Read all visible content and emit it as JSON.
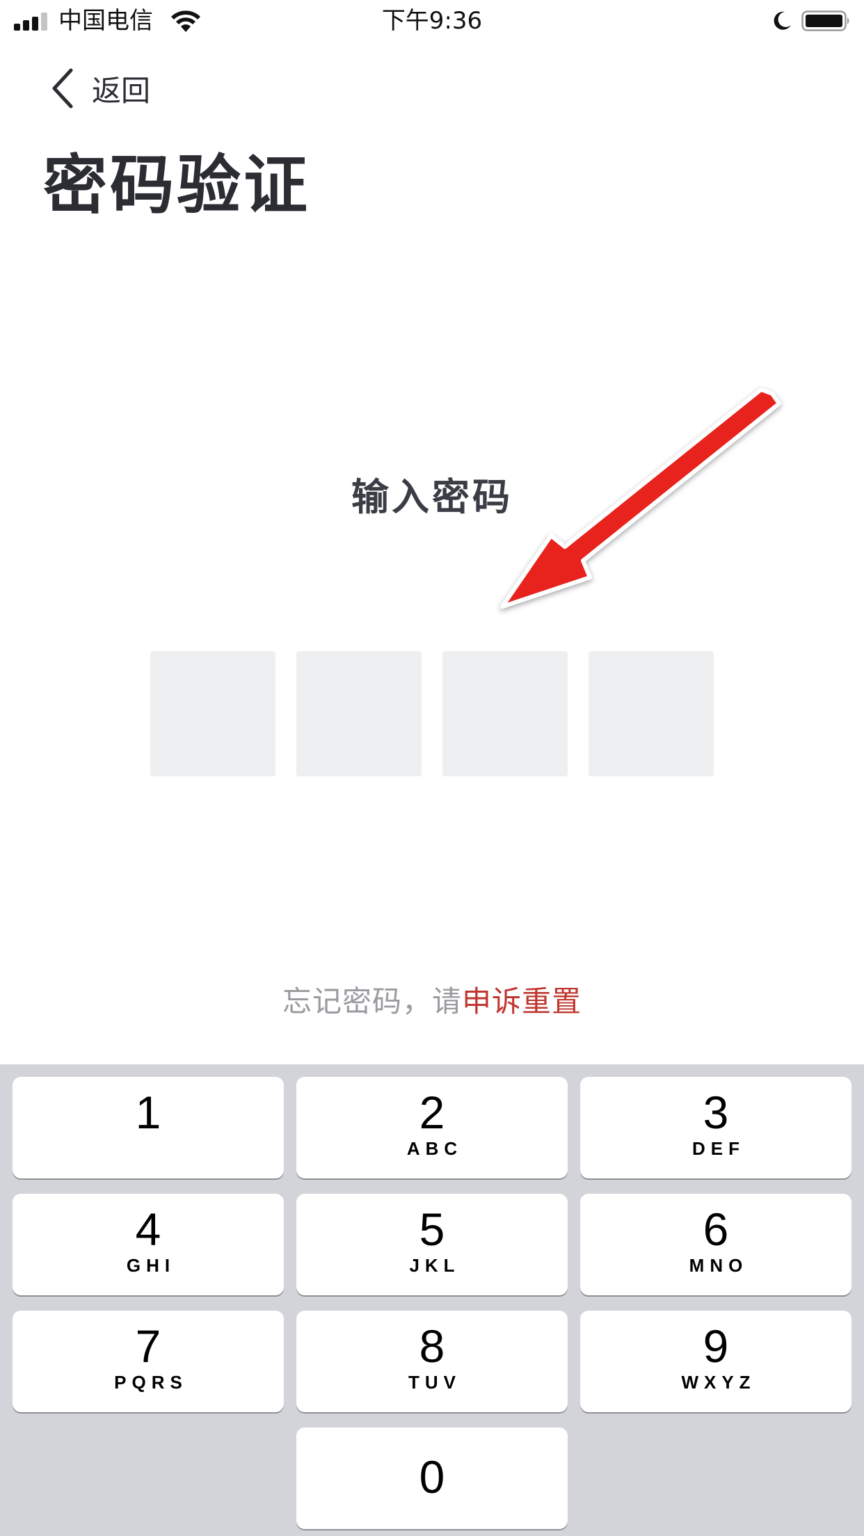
{
  "status_bar": {
    "carrier": "中国电信",
    "time": "下午9:36",
    "signal_bars_active": 3,
    "signal_bars_total": 4,
    "icons": [
      "signal-icon",
      "wifi-icon",
      "moon-icon",
      "battery-icon"
    ]
  },
  "nav": {
    "back_label": "返回",
    "back_icon": "chevron-left-icon"
  },
  "page": {
    "title": "密码验证",
    "prompt": "输入密码",
    "code_length": 4
  },
  "forgot": {
    "text": "忘记密码，请",
    "link": "申诉重置"
  },
  "annotation": {
    "icon": "red-arrow-icon",
    "color": "#e8211a"
  },
  "keypad": {
    "keys": [
      {
        "digit": "1",
        "letters": ""
      },
      {
        "digit": "2",
        "letters": "ABC"
      },
      {
        "digit": "3",
        "letters": "DEF"
      },
      {
        "digit": "4",
        "letters": "GHI"
      },
      {
        "digit": "5",
        "letters": "JKL"
      },
      {
        "digit": "6",
        "letters": "MNO"
      },
      {
        "digit": "7",
        "letters": "PQRS"
      },
      {
        "digit": "8",
        "letters": "TUV"
      },
      {
        "digit": "9",
        "letters": "WXYZ"
      },
      {
        "digit": "0",
        "letters": ""
      }
    ]
  },
  "colors": {
    "title": "#2b2d33",
    "link": "#c0372f",
    "keypad_bg": "#d2d4d9",
    "code_box": "#eeeff1"
  }
}
